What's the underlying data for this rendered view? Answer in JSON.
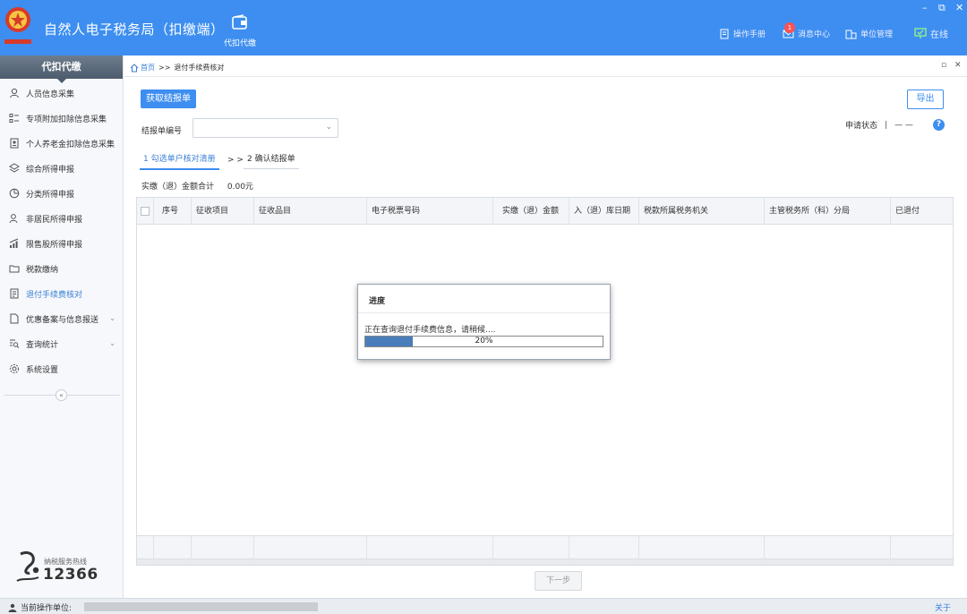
{
  "app": {
    "title": "自然人电子税务局（扣缴端）",
    "tab_label": "代扣代缴",
    "logo_text": "中国税务"
  },
  "top_nav": {
    "manual": "操作手册",
    "messages": "消息中心",
    "unit": "单位管理",
    "online": "在线",
    "message_badge": "1"
  },
  "window_controls": {
    "minimize": "–",
    "restore": "⧉",
    "close": "✕"
  },
  "sidebar": {
    "header": "代扣代缴",
    "items": [
      {
        "label": "人员信息采集",
        "icon": "person-icon"
      },
      {
        "label": "专项附加扣除信息采集",
        "icon": "list-icon"
      },
      {
        "label": "个人养老金扣除信息采集",
        "icon": "pension-icon"
      },
      {
        "label": "综合所得申报",
        "icon": "layers-icon"
      },
      {
        "label": "分类所得申报",
        "icon": "pie-icon"
      },
      {
        "label": "非居民所得申报",
        "icon": "person-outline-icon"
      },
      {
        "label": "限售股所得申报",
        "icon": "bar-signal-icon"
      },
      {
        "label": "税款缴纳",
        "icon": "folder-icon"
      },
      {
        "label": "退付手续费核对",
        "icon": "document-check-icon",
        "active": true
      },
      {
        "label": "优惠备案与信息报送",
        "icon": "file-icon",
        "expandable": true
      },
      {
        "label": "查询统计",
        "icon": "search-list-icon",
        "expandable": true
      },
      {
        "label": "系统设置",
        "icon": "gear-icon"
      }
    ],
    "collapse_glyph": "«",
    "hotline_label": "纳税服务热线",
    "hotline_number": "12366"
  },
  "breadcrumb": {
    "home": "首页",
    "separator": ">>",
    "current": "退付手续费核对"
  },
  "page": {
    "fetch_button": "获取结报单",
    "export_button": "导出",
    "bill_label": "结报单编号",
    "bill_value": "",
    "status_label": "申请状态",
    "status_sep": "|",
    "status_value": "— —",
    "help_glyph": "?",
    "steps": [
      {
        "label": "1 勾选单户核对清册",
        "active": true
      },
      {
        "label": "2 确认结报单",
        "active": false
      }
    ],
    "step_separator": "> >",
    "total_label": "实缴（退）金额合计",
    "total_value": "0.00元",
    "next_button": "下一步"
  },
  "table": {
    "columns": [
      "序号",
      "征收项目",
      "征收品目",
      "电子税票号码",
      "实缴（退）金额",
      "入（退）库日期",
      "税款所属税务机关",
      "主管税务所（科）分局",
      "已退付"
    ]
  },
  "dialog": {
    "title": "进度",
    "message": "正在查询退付手续费信息，请稍候....",
    "progress_percent": 20,
    "progress_label": "20%"
  },
  "statusbar": {
    "operator_label": "当前操作单位:",
    "about": "关于"
  },
  "colors": {
    "primary": "#3d8ef0",
    "progress": "#4a7ebb",
    "active_text": "#3a7fd6"
  }
}
